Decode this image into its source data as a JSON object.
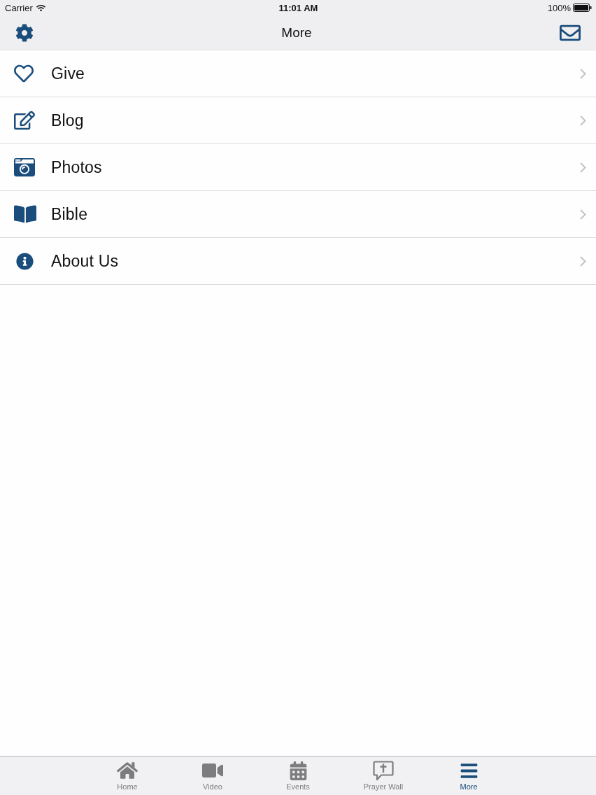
{
  "status_bar": {
    "carrier": "Carrier",
    "time": "11:01 AM",
    "battery": "100%"
  },
  "nav_bar": {
    "title": "More"
  },
  "menu_items": [
    {
      "label": "Give"
    },
    {
      "label": "Blog"
    },
    {
      "label": "Photos"
    },
    {
      "label": "Bible"
    },
    {
      "label": "About Us"
    }
  ],
  "tab_bar": [
    {
      "label": "Home",
      "selected": false
    },
    {
      "label": "Video",
      "selected": false
    },
    {
      "label": "Events",
      "selected": false
    },
    {
      "label": "Prayer Wall",
      "selected": false
    },
    {
      "label": "More",
      "selected": true
    }
  ]
}
